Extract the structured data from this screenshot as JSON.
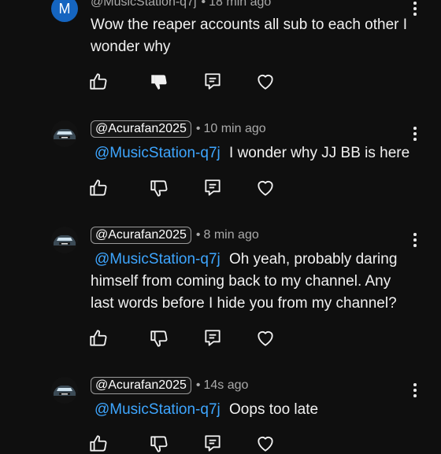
{
  "comments": [
    {
      "avatar_letter": "M",
      "author": "@MusicStation-q7j",
      "time": "18 min ago",
      "mention": "",
      "text": "Wow the reaper accounts all sub to each other I wonder why"
    },
    {
      "author": "@Acurafan2025",
      "time": "10 min ago",
      "mention": "@MusicStation-q7j",
      "text": "I wonder why JJ BB is here"
    },
    {
      "author": "@Acurafan2025",
      "time": "8 min ago",
      "mention": "@MusicStation-q7j",
      "text": "Oh yeah, probably daring himself from coming back to my channel. Any last words before I hide you from my channel?"
    },
    {
      "author": "@Acurafan2025",
      "time": "14s ago",
      "mention": "@MusicStation-q7j",
      "text": "Oops too late"
    }
  ],
  "separator": "•",
  "colors": {
    "background": "#0f0f0f",
    "mention": "#3ea6ff",
    "avatar_letter_bg": "#1565c0",
    "text": "#f1f1f1",
    "meta": "#aaaaaa"
  },
  "icons": [
    "thumbs-up-icon",
    "thumbs-down-icon",
    "reply-icon",
    "heart-icon",
    "more-vert-icon"
  ]
}
